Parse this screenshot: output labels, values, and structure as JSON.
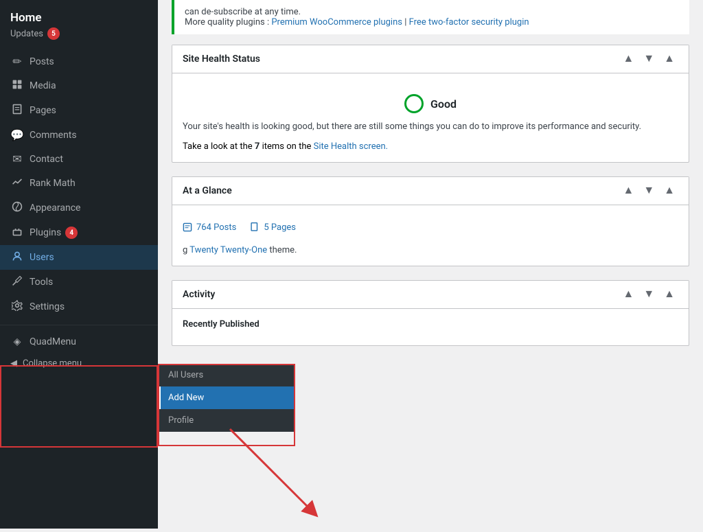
{
  "sidebar": {
    "home_label": "Home",
    "updates_label": "Updates",
    "updates_count": "5",
    "menu_items": [
      {
        "id": "posts",
        "label": "Posts",
        "icon": "✏️"
      },
      {
        "id": "media",
        "label": "Media",
        "icon": "🖼️"
      },
      {
        "id": "pages",
        "label": "Pages",
        "icon": "📄"
      },
      {
        "id": "comments",
        "label": "Comments",
        "icon": "💬"
      },
      {
        "id": "contact",
        "label": "Contact",
        "icon": "✉️"
      },
      {
        "id": "rankmath",
        "label": "Rank Math",
        "icon": "📊"
      },
      {
        "id": "appearance",
        "label": "Appearance",
        "icon": "🎨"
      },
      {
        "id": "plugins",
        "label": "Plugins",
        "icon": "🔌",
        "badge": "4"
      },
      {
        "id": "users",
        "label": "Users",
        "icon": "👤",
        "active": true
      },
      {
        "id": "tools",
        "label": "Tools",
        "icon": "🔧"
      },
      {
        "id": "settings",
        "label": "Settings",
        "icon": "⚙️"
      }
    ],
    "users_submenu": [
      {
        "id": "all-users",
        "label": "All Users"
      },
      {
        "id": "add-new",
        "label": "Add New",
        "active": true
      },
      {
        "id": "profile",
        "label": "Profile"
      }
    ],
    "quad_menu_label": "QuadMenu",
    "quad_menu_icon": "◈",
    "collapse_label": "Collapse menu",
    "collapse_icon": "◀"
  },
  "main": {
    "top_notice": {
      "text": "can de-subscribe at any time.",
      "quality_label": "More quality plugins :",
      "link1_text": "Premium WooCommerce plugins",
      "link2_text": "Free two-factor security plugin"
    },
    "site_health": {
      "title": "Site Health Status",
      "status": "Good",
      "description": "Your site's health is looking good, but there are still some things you can do to improve its performance and security.",
      "items_count": "7",
      "items_label": "items",
      "link_text": "Site Health screen.",
      "take_look_text": "Take a look at the",
      "on_the_text": "on the"
    },
    "at_a_glance": {
      "title": "At a Glance",
      "posts_label": "764 Posts",
      "pages_label": "5 Pages",
      "theme_text": "g Twenty Twenty-One theme."
    },
    "activity": {
      "title": "Activity",
      "recent_published": "Recently Published"
    }
  },
  "controls": {
    "up_arrow": "▲",
    "down_arrow": "▼",
    "minimize_arrow": "▲"
  }
}
